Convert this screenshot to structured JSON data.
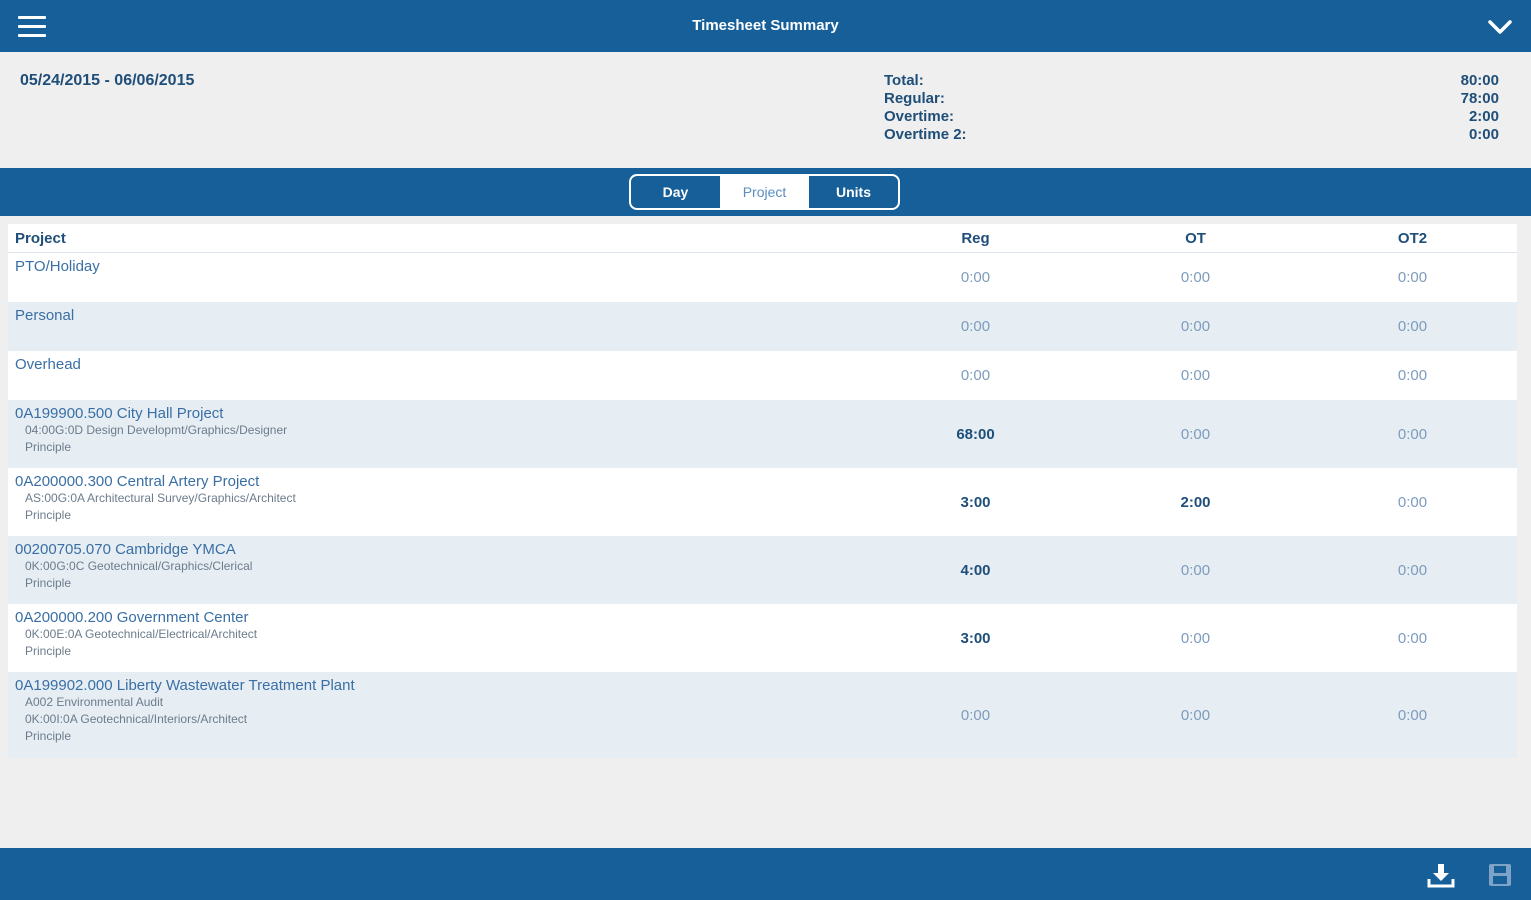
{
  "header": {
    "title": "Timesheet Summary"
  },
  "summary": {
    "date_range": "05/24/2015 - 06/06/2015",
    "totals": [
      {
        "label": "Total:",
        "value": "80:00"
      },
      {
        "label": "Regular:",
        "value": "78:00"
      },
      {
        "label": "Overtime:",
        "value": "2:00"
      },
      {
        "label": "Overtime 2:",
        "value": "0:00"
      }
    ]
  },
  "tabs": [
    {
      "label": "Day",
      "active": false
    },
    {
      "label": "Project",
      "active": true
    },
    {
      "label": "Units",
      "active": false
    }
  ],
  "table": {
    "columns": {
      "project": "Project",
      "reg": "Reg",
      "ot": "OT",
      "ot2": "OT2"
    },
    "rows": [
      {
        "name": "PTO/Holiday",
        "details": [],
        "reg": "0:00",
        "ot": "0:00",
        "ot2": "0:00"
      },
      {
        "name": "Personal",
        "details": [],
        "reg": "0:00",
        "ot": "0:00",
        "ot2": "0:00"
      },
      {
        "name": "Overhead",
        "details": [],
        "reg": "0:00",
        "ot": "0:00",
        "ot2": "0:00"
      },
      {
        "name": "0A199900.500 City Hall Project",
        "details": [
          "04:00G:0D Design Developmt/Graphics/Designer",
          "Principle"
        ],
        "reg": "68:00",
        "ot": "0:00",
        "ot2": "0:00"
      },
      {
        "name": "0A200000.300 Central Artery Project",
        "details": [
          "AS:00G:0A Architectural Survey/Graphics/Architect",
          "Principle"
        ],
        "reg": "3:00",
        "ot": "2:00",
        "ot2": "0:00"
      },
      {
        "name": "00200705.070 Cambridge YMCA",
        "details": [
          "0K:00G:0C Geotechnical/Graphics/Clerical",
          "Principle"
        ],
        "reg": "4:00",
        "ot": "0:00",
        "ot2": "0:00"
      },
      {
        "name": "0A200000.200 Government Center",
        "details": [
          "0K:00E:0A Geotechnical/Electrical/Architect",
          "Principle"
        ],
        "reg": "3:00",
        "ot": "0:00",
        "ot2": "0:00"
      },
      {
        "name": "0A199902.000 Liberty Wastewater Treatment Plant",
        "details": [
          "A002 Environmental Audit",
          "0K:00I:0A Geotechnical/Interiors/Architect",
          "Principle"
        ],
        "reg": "0:00",
        "ot": "0:00",
        "ot2": "0:00"
      }
    ]
  },
  "icons": {
    "menu": "hamburger-icon",
    "collapse": "chevron-down-icon",
    "download": "download-icon",
    "save": "save-icon"
  },
  "colors": {
    "primary": "#165f99",
    "text": "#1f4e79",
    "row_alt": "#e6edf3"
  }
}
